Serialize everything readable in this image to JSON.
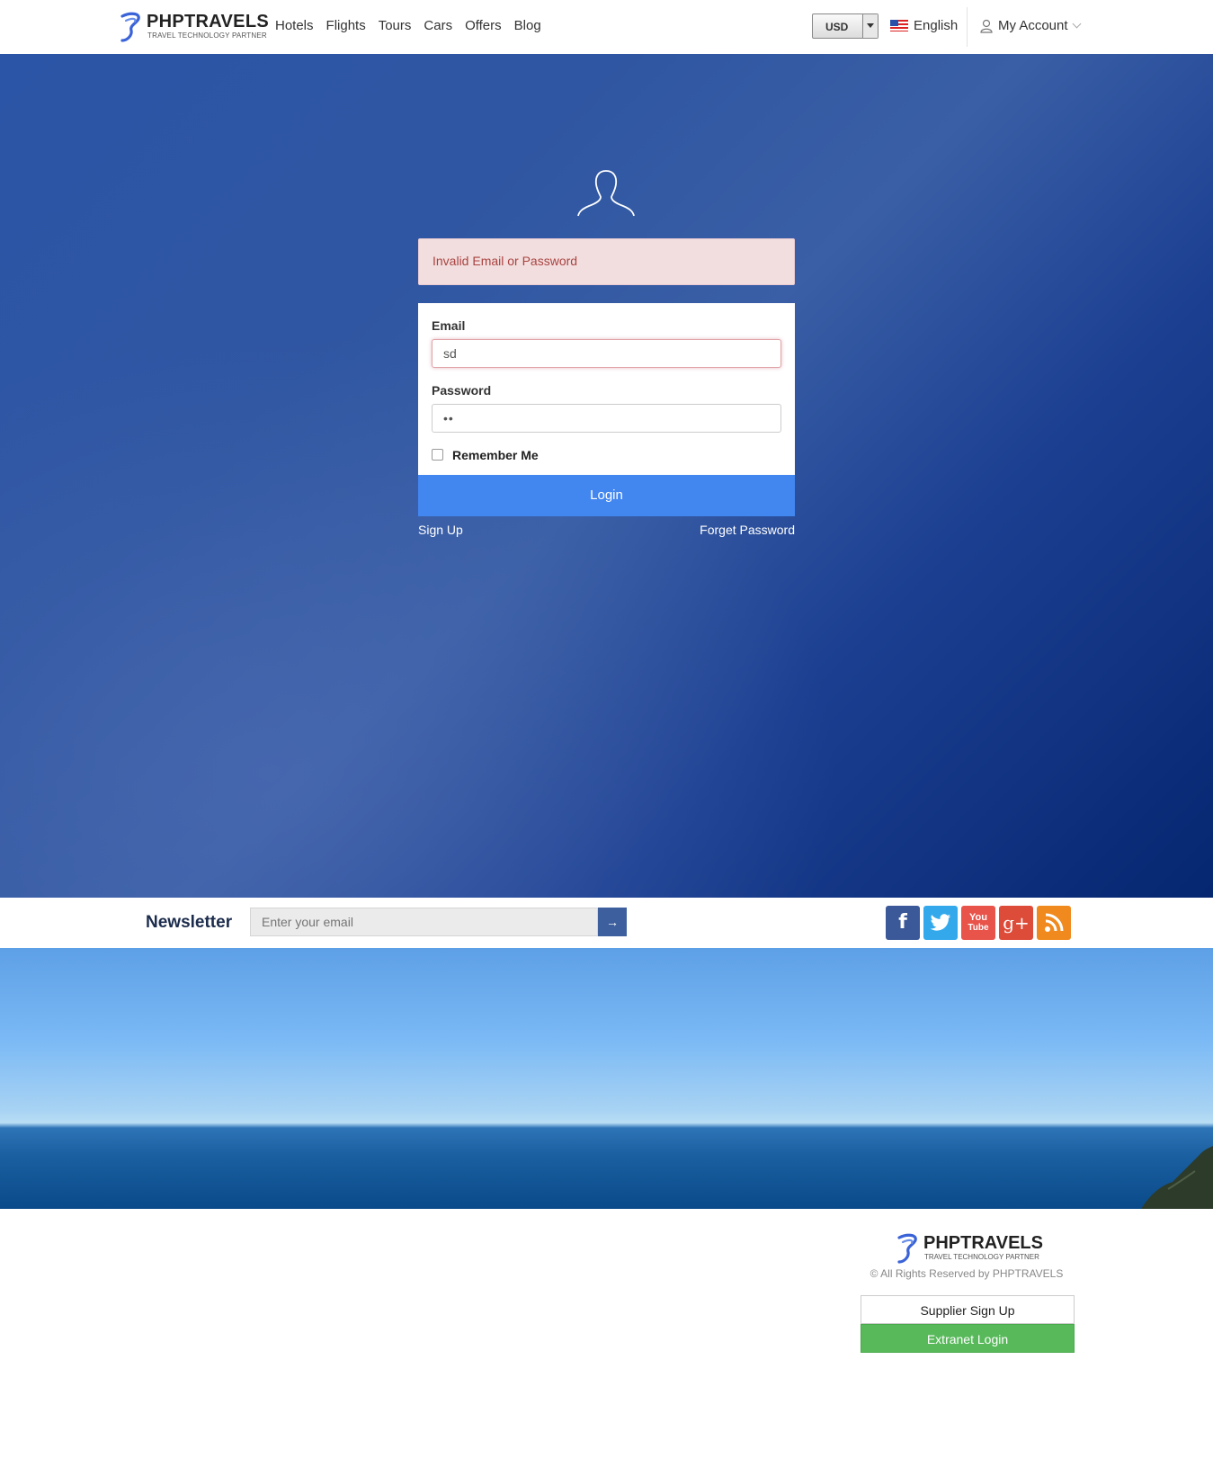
{
  "brand": {
    "name": "PHPTRAVELS",
    "tagline": "TRAVEL TECHNOLOGY PARTNER",
    "accent": "#4286f0"
  },
  "nav": {
    "items": [
      "Hotels",
      "Flights",
      "Tours",
      "Cars",
      "Offers",
      "Blog"
    ]
  },
  "header": {
    "currency": "USD",
    "language": "English",
    "account": "My Account"
  },
  "login": {
    "alert": "Invalid Email or Password",
    "email_label": "Email",
    "email_value": "sd",
    "password_label": "Password",
    "password_value": "••",
    "remember_label": "Remember Me",
    "login_button": "Login",
    "signup_link": "Sign Up",
    "forget_link": "Forget Password"
  },
  "newsletter": {
    "title": "Newsletter",
    "placeholder": "Enter your email",
    "submit_icon": "arrow-right-icon"
  },
  "social": [
    {
      "name": "facebook-icon",
      "glyph": "f",
      "color": "#3b5998"
    },
    {
      "name": "twitter-icon",
      "glyph": "t",
      "color": "#33a9ec"
    },
    {
      "name": "youtube-icon",
      "glyph": "You Tube",
      "color": "#e8534a"
    },
    {
      "name": "googleplus-icon",
      "glyph": "g+",
      "color": "#dd4b39"
    },
    {
      "name": "rss-icon",
      "glyph": "rss",
      "color": "#f0891e"
    }
  ],
  "footer": {
    "copyright": "© All Rights Reserved by PHPTRAVELS",
    "supplier_signup": "Supplier Sign Up",
    "extranet_login": "Extranet Login"
  }
}
